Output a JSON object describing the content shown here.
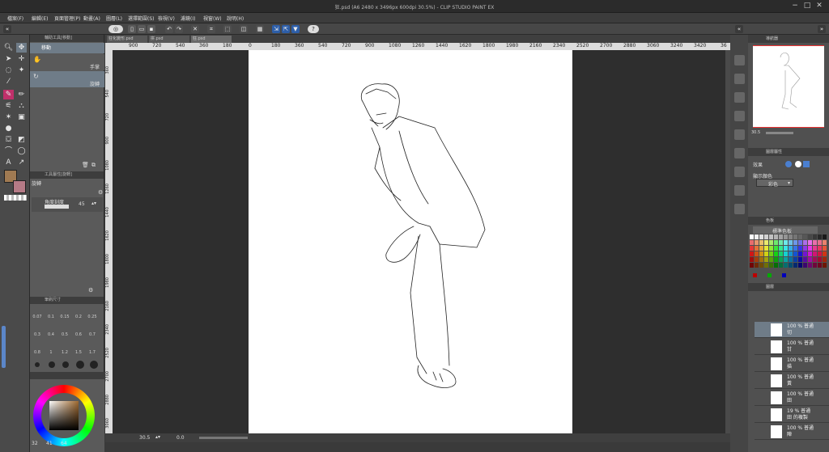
{
  "window": {
    "title": "狂.psd (A6 2480 x 3496px 600dpi 30.5%) - CLIP STUDIO PAINT EX",
    "minimize": "−",
    "maximize": "□",
    "close": "✕"
  },
  "menu": [
    "檔案(F)",
    "編輯(E)",
    "頁面管理(P)",
    "動畫(A)",
    "圖層(L)",
    "選擇範圍(S)",
    "檢視(V)",
    "濾鏡(I)",
    "視窗(W)",
    "說明(H)"
  ],
  "tabs": [
    "狂化變形.psd",
    "拼.psd",
    "狂.psd"
  ],
  "ruler_h": [
    "900",
    "720",
    "540",
    "360",
    "180",
    "0",
    "180",
    "360",
    "540",
    "720",
    "900",
    "1080",
    "1260",
    "1440",
    "1620",
    "1800",
    "1980",
    "2160",
    "2340",
    "2520",
    "2700",
    "2880",
    "3060",
    "3240",
    "3420",
    "36"
  ],
  "ruler_v": [
    "360",
    "540",
    "720",
    "900",
    "1080",
    "1260",
    "1440",
    "1620",
    "1800",
    "1980",
    "2160",
    "2340",
    "2520",
    "2700",
    "2880",
    "3060"
  ],
  "subtool": {
    "header": "輔助工具[移動]",
    "group": "移動",
    "items": [
      "手掌",
      "旋轉"
    ]
  },
  "toolprop": {
    "header": "工具屬性[旋轉]",
    "title": "旋轉",
    "angle_label": "角度刻度",
    "angle_value": "45"
  },
  "brushsize": {
    "header": "筆刷尺寸",
    "sizes": [
      "0.07",
      "0.1",
      "0.15",
      "0.2",
      "0.25",
      "0.3",
      "0.4",
      "0.5",
      "0.6",
      "0.7",
      "0.8",
      "1",
      "1.2",
      "1.5",
      "1.7"
    ]
  },
  "colorwheel": {
    "values": [
      "32",
      "41",
      "64"
    ]
  },
  "status": {
    "zoom": "30.5",
    "angle": "0.0"
  },
  "navigator": {
    "header": "導航器",
    "zoom": "30.5"
  },
  "effects": {
    "header": "圖層屬性",
    "effect_label": "效果",
    "display_color_label": "顯示顏色",
    "display_color_value": "彩色"
  },
  "palette": {
    "header": "色板",
    "set": "標準色板"
  },
  "layers": {
    "header": "圖層",
    "items": [
      {
        "top": "100 % 普通",
        "bottom": "切"
      },
      {
        "top": "100 % 普通",
        "bottom": "甘"
      },
      {
        "top": "100 % 普通",
        "bottom": "描"
      },
      {
        "top": "100 % 普通",
        "bottom": "黃"
      },
      {
        "top": "100 % 普通",
        "bottom": "田"
      },
      {
        "top": "19 % 普通",
        "bottom": "田 的複製"
      },
      {
        "top": "100 % 普通",
        "bottom": "陣"
      }
    ]
  },
  "colors": {
    "main": "#a07a52",
    "sub": "#b57a86"
  }
}
